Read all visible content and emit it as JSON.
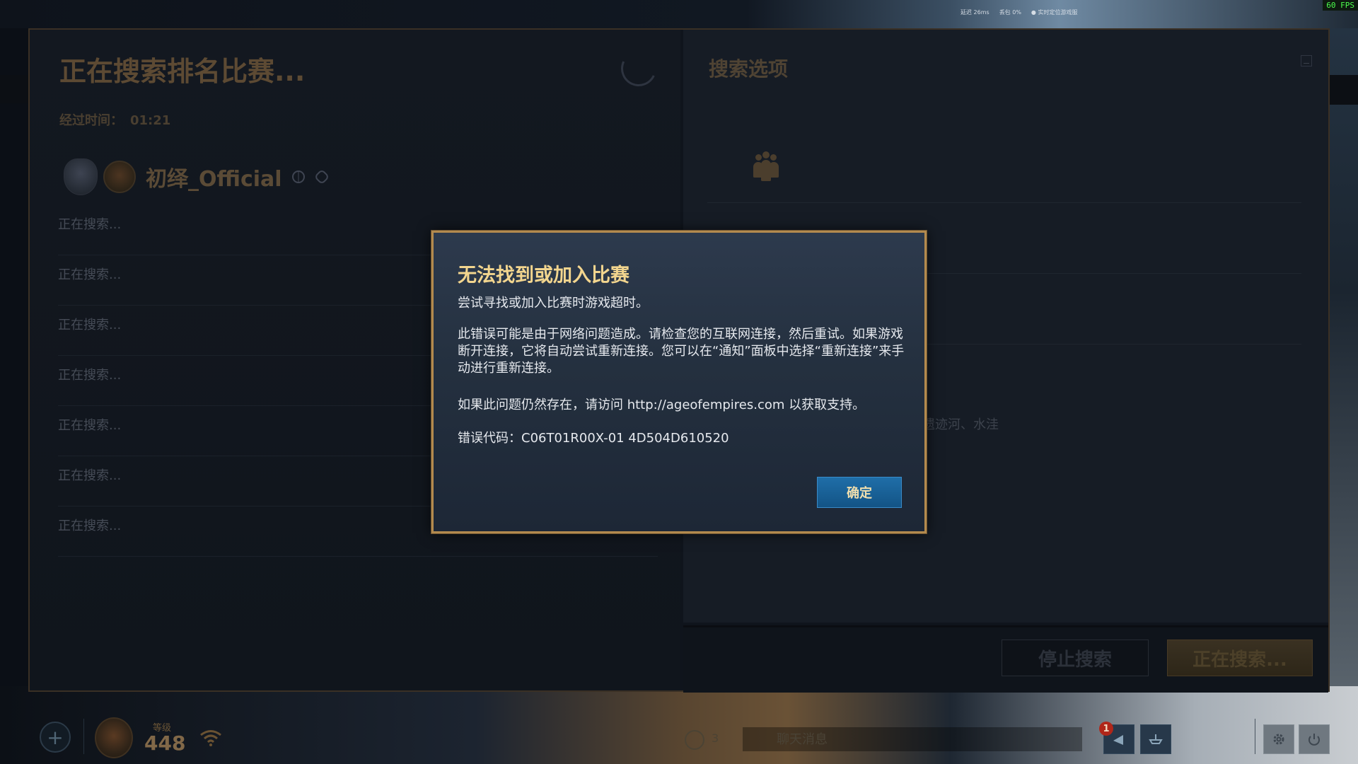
{
  "status_overlay": {
    "latency": "延迟 26ms",
    "packet_loss": "丢包 0%",
    "location": "实时定位游戏服",
    "fps": "60 FPS"
  },
  "search_panel": {
    "title": "正在搜索排名比赛...",
    "elapsed_label": "经过时间：",
    "elapsed_value": "01:21",
    "player_name": "初绎_Official",
    "slots": [
      "正在搜索...",
      "正在搜索...",
      "正在搜索...",
      "正在搜索...",
      "正在搜索...",
      "正在搜索...",
      "正在搜索..."
    ]
  },
  "options_panel": {
    "title": "搜索选项",
    "partial_text_1": ")",
    "partial_text_2": "遗迹河、水洼",
    "stop_button": "停止搜索",
    "searching_button": "正在搜索..."
  },
  "dialog": {
    "title": "无法找到或加入比赛",
    "subtitle": "尝试寻找或加入比赛时游戏超时。",
    "body": "此错误可能是由于网络问题造成。请检查您的互联网连接，然后重试。如果游戏断开连接，它将自动尝试重新连接。您可以在“通知”面板中选择“重新连接”来手动进行重新连接。",
    "support": "如果此问题仍然存在，请访问 http://ageofempires.com 以获取支持。",
    "error_label": "错误代码：",
    "error_code": "C06T01R00X-01 4D504D610520",
    "ok_button": "确定"
  },
  "bottom_bar": {
    "level_label": "等级",
    "level_value": "448",
    "chat_count": "3",
    "chat_placeholder": "聊天消息",
    "notification_count": "1"
  },
  "colors": {
    "dialog_border": "#b38a4e",
    "dialog_title": "#f2d58e",
    "ok_button": "#1a6399",
    "notification_badge": "#b02619"
  }
}
